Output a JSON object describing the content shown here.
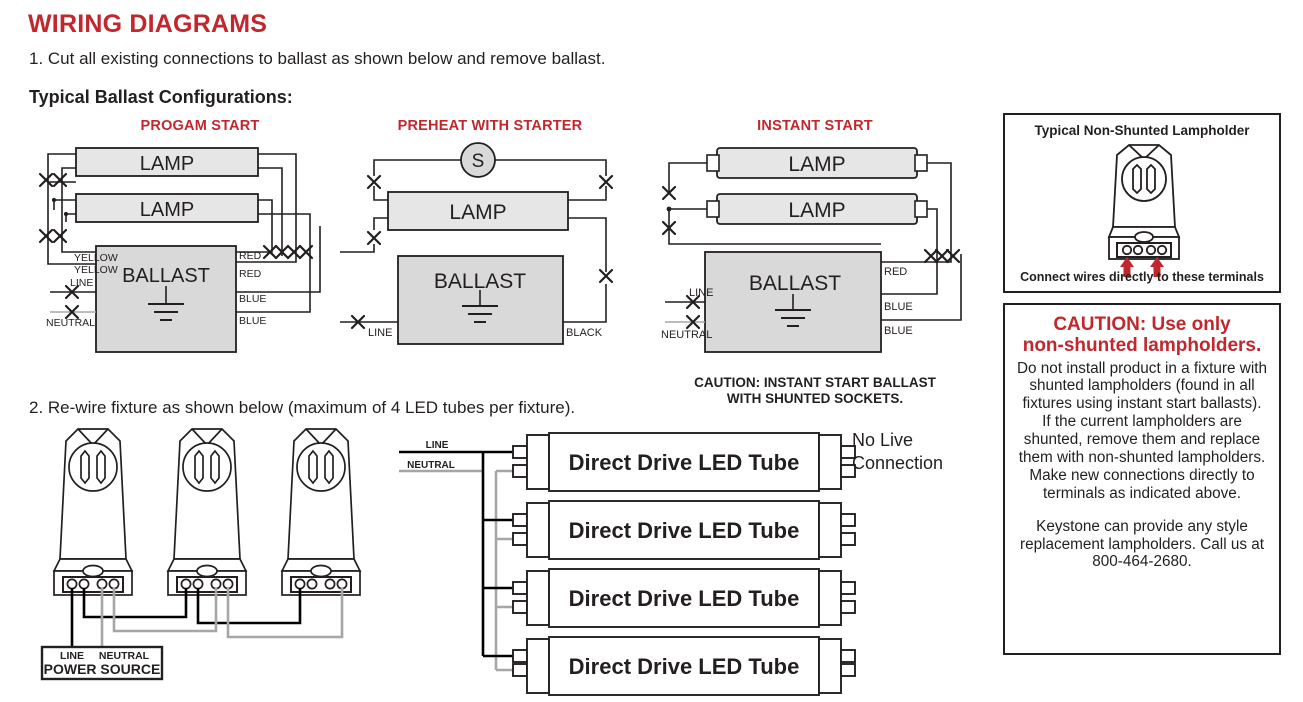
{
  "page": {
    "title": "WIRING DIAGRAMS",
    "step1": "1. Cut all existing connections to ballast as shown below and remove ballast.",
    "typical_config_label": "Typical Ballast Configurations:",
    "step2": "2. Re-wire fixture as shown below (maximum of 4 LED tubes per fixture).",
    "accent_red": "#c1272d",
    "ink": "#231f20",
    "component_fill": "#d9d9d9",
    "lamp_fill": "#e6e6e6",
    "neutral_wire_gray": "#a6a6a6"
  },
  "diagrams": {
    "program_start": {
      "title": "PROGAM START",
      "lamp1": "LAMP",
      "lamp2": "LAMP",
      "ballast": "BALLAST",
      "wires": {
        "yellow1": "YELLOW",
        "yellow2": "YELLOW",
        "line": "LINE",
        "neutral": "NEUTRAL",
        "red1": "RED",
        "red2": "RED",
        "blue1": "BLUE",
        "blue2": "BLUE"
      }
    },
    "preheat_with_starter": {
      "title": "PREHEAT WITH STARTER",
      "starter": "S",
      "lamp": "LAMP",
      "ballast": "BALLAST",
      "wires": {
        "line": "LINE",
        "black": "BLACK"
      }
    },
    "instant_start": {
      "title": "INSTANT START",
      "lamp1": "LAMP",
      "lamp2": "LAMP",
      "ballast": "BALLAST",
      "wires": {
        "red": "RED",
        "blue1": "BLUE",
        "blue2": "BLUE",
        "line": "LINE",
        "neutral": "NEUTRAL"
      },
      "caution_line1": "CAUTION: INSTANT START BALLAST",
      "caution_line2": "WITH SHUNTED SOCKETS."
    },
    "rewire": {
      "power_source": {
        "line": "LINE",
        "neutral": "NEUTRAL",
        "title": "POWER SOURCE"
      },
      "feed": {
        "line": "LINE",
        "neutral": "NEUTRAL"
      },
      "tubes": [
        "Direct Drive LED Tube",
        "Direct Drive LED Tube",
        "Direct Drive LED Tube",
        "Direct Drive LED Tube"
      ],
      "no_live_connection_line1": "No Live",
      "no_live_connection_line2": "Connection"
    }
  },
  "info_panel": {
    "lampholder_title": "Typical Non-Shunted Lampholder",
    "lampholder_footer": "Connect wires directly to these terminals",
    "caution_heading_line1": "CAUTION: Use only",
    "caution_heading_line2": "non-shunted lampholders.",
    "caution_body": "Do not install product in a fixture with shunted lampholders (found in all fixtures using instant start ballasts). If the current lampholders are shunted, remove them and replace them with non-shunted lampholders. Make new connections directly to terminals as indicated above.",
    "caution_contact": "Keystone can provide any style replacement lampholders. Call us at 800-464-2680."
  }
}
